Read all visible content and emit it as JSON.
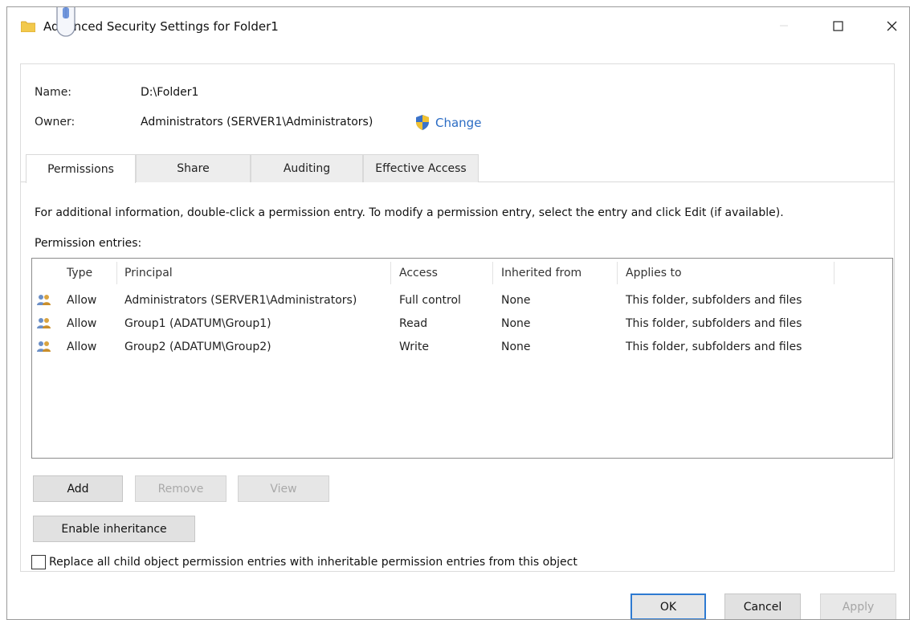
{
  "window": {
    "title": "Advanced Security Settings for Folder1"
  },
  "info": {
    "name_label": "Name:",
    "name_value": "D:\\Folder1",
    "owner_label": "Owner:",
    "owner_value": "Administrators (SERVER1\\Administrators)",
    "change_link": "Change"
  },
  "tabs": [
    {
      "label": "Permissions",
      "active": true
    },
    {
      "label": "Share",
      "active": false
    },
    {
      "label": "Auditing",
      "active": false
    },
    {
      "label": "Effective Access",
      "active": false
    }
  ],
  "hint": "For additional information, double-click a permission entry. To modify a permission entry, select the entry and click Edit (if available).",
  "entries_label": "Permission entries:",
  "table": {
    "columns": [
      "Type",
      "Principal",
      "Access",
      "Inherited from",
      "Applies to"
    ],
    "rows": [
      [
        "Allow",
        "Administrators (SERVER1\\Administrators)",
        "Full control",
        "None",
        "This folder, subfolders and files"
      ],
      [
        "Allow",
        "Group1 (ADATUM\\Group1)",
        "Read",
        "None",
        "This folder, subfolders and files"
      ],
      [
        "Allow",
        "Group2 (ADATUM\\Group2)",
        "Write",
        "None",
        "This folder, subfolders and files"
      ]
    ]
  },
  "buttons": {
    "add": "Add",
    "remove": "Remove",
    "view": "View",
    "enable_inheritance": "Enable inheritance"
  },
  "replace_checkbox": {
    "label": "Replace all child object permission entries with inheritable permission entries from this object",
    "checked": false
  },
  "footer": {
    "ok": "OK",
    "cancel": "Cancel",
    "apply": "Apply"
  },
  "colors": {
    "link": "#2b6cc4",
    "default_button_border": "#2e7ad1",
    "disabled_text": "#a9a9a9"
  },
  "icons": [
    "folder-icon",
    "shield-icon",
    "user-group-icon",
    "minimize-icon",
    "maximize-icon",
    "close-icon",
    "cursor-icon"
  ]
}
